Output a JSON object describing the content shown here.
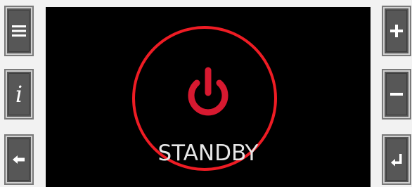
{
  "display": {
    "status_text": "STANDBY",
    "ring_color": "#ee1c24",
    "power_icon_color": "#d71930",
    "background_color": "#000000",
    "text_color": "#e6e6e6"
  },
  "left_buttons": [
    {
      "icon": "menu-icon"
    },
    {
      "icon": "info-icon",
      "glyph": "i"
    },
    {
      "icon": "arrow-left-icon"
    }
  ],
  "right_buttons": [
    {
      "icon": "plus-icon"
    },
    {
      "icon": "minus-icon"
    },
    {
      "icon": "enter-return-icon"
    }
  ]
}
